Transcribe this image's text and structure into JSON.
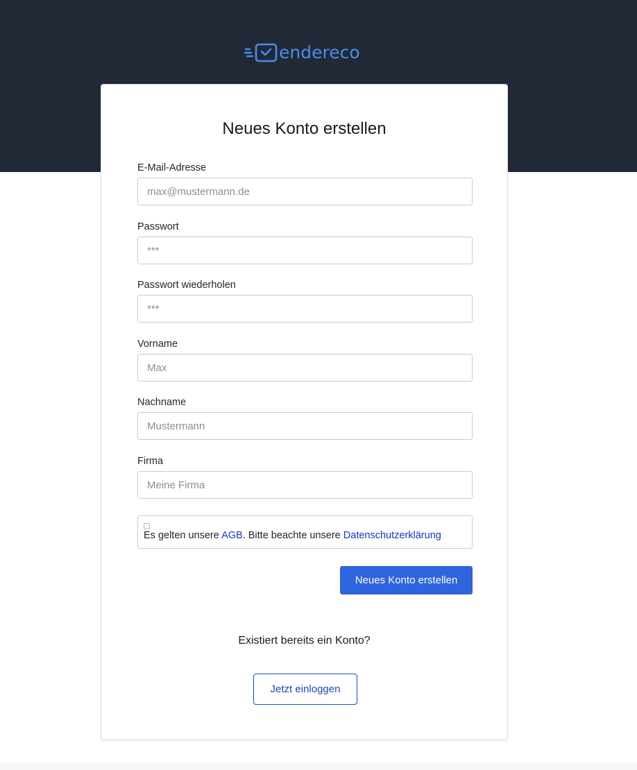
{
  "brand": {
    "name": "endereco",
    "color": "#4a8fe8",
    "logo_icon": "envelope-check-icon"
  },
  "form": {
    "title": "Neues Konto erstellen",
    "fields": [
      {
        "label": "E-Mail-Adresse",
        "placeholder": "max@mustermann.de",
        "value": ""
      },
      {
        "label": "Passwort",
        "placeholder": "***",
        "value": ""
      },
      {
        "label": "Passwort wiederholen",
        "placeholder": "***",
        "value": ""
      },
      {
        "label": "Vorname",
        "placeholder": "Max",
        "value": ""
      },
      {
        "label": "Nachname",
        "placeholder": "Mustermann",
        "value": ""
      },
      {
        "label": "Firma",
        "placeholder": "Meine Firma",
        "value": ""
      }
    ],
    "consent": {
      "checked": false,
      "text_before": "Es gelten unsere ",
      "agb_link": "AGB",
      "text_middle": ". Bitte beachte unsere ",
      "privacy_link": "Datenschutzerklärung"
    },
    "submit_label": "Neues Konto erstellen"
  },
  "login": {
    "question": "Existiert bereits ein Konto?",
    "button_label": "Jetzt einloggen"
  },
  "colors": {
    "header_background": "#212836",
    "primary": "#2f64df",
    "link": "#1535c4"
  }
}
